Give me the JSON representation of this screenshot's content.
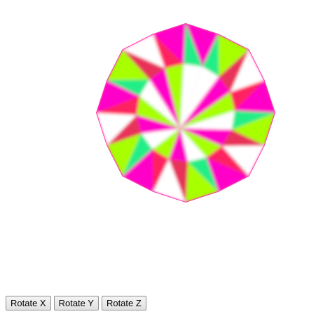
{
  "canvas": {
    "object": "rotating multicolor polyhedron",
    "palette": [
      "#ff00c8",
      "#ff2060",
      "#ffd800",
      "#a8ff00",
      "#22ee88",
      "#1a2a9a",
      "#ffffff",
      "#e8305a",
      "#ff7a00"
    ]
  },
  "controls": {
    "rotate_x_label": "Rotate X",
    "rotate_y_label": "Rotate Y",
    "rotate_z_label": "Rotate Z"
  }
}
